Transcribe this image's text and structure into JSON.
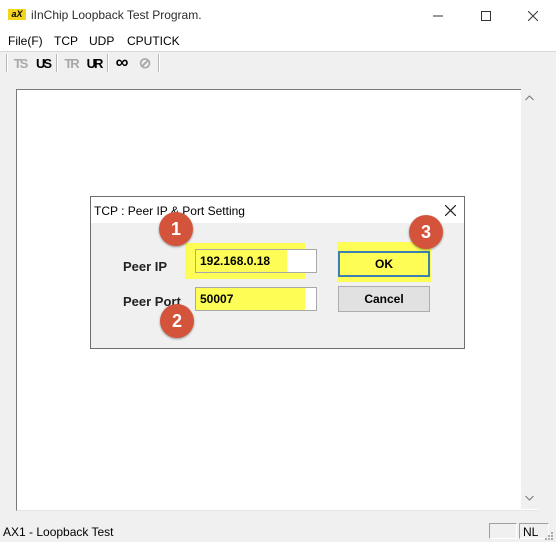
{
  "window": {
    "app_icon_text": "aX",
    "title": "iInChip Loopback Test Program."
  },
  "menu": {
    "items": [
      "File(F)",
      "TCP",
      "UDP",
      "CPUTICK"
    ]
  },
  "toolbar": {
    "buttons": [
      {
        "label": "TS",
        "icon": "tcp-server-icon"
      },
      {
        "label": "US",
        "icon": "udp-server-icon"
      },
      {
        "label": "TR",
        "icon": "tcp-recv-icon"
      },
      {
        "label": "UR",
        "icon": "udp-recv-icon"
      },
      {
        "label": "∞",
        "icon": "loop-icon"
      },
      {
        "label": "⊘",
        "icon": "stop-icon"
      }
    ]
  },
  "status": {
    "text": "AX1 - Loopback Test",
    "pane_nl": "NL"
  },
  "dialog": {
    "title": "TCP : Peer IP & Port Setting",
    "peer_ip_label": "Peer IP",
    "peer_ip_value": "192.168.0.18",
    "peer_port_label": "Peer Port",
    "peer_port_value": "50007",
    "ok_label": "OK",
    "cancel_label": "Cancel"
  },
  "annotations": {
    "marker_1": "1",
    "marker_2": "2",
    "marker_3": "3",
    "marker_color": "#d4543b",
    "highlight_color": "#fdfd55"
  }
}
